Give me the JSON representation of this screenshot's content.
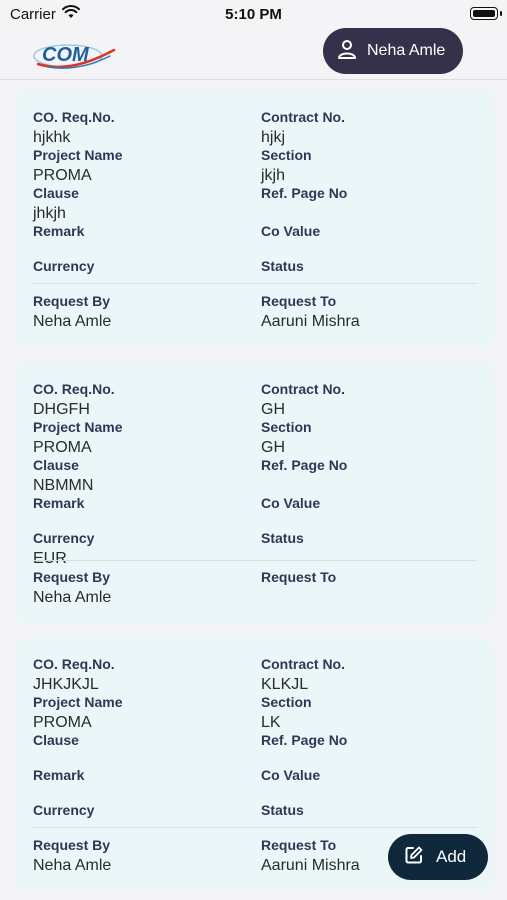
{
  "status": {
    "carrier": "Carrier",
    "time": "5:10 PM"
  },
  "header": {
    "logo_text": "COM",
    "user_name": "Neha Amle"
  },
  "labels": {
    "co_req_no": "CO. Req.No.",
    "contract_no": "Contract No.",
    "project_name": "Project Name",
    "section": "Section",
    "clause": "Clause",
    "ref_page_no": "Ref. Page No",
    "remark": "Remark",
    "co_value": "Co Value",
    "currency": "Currency",
    "status": "Status",
    "request_by": "Request By",
    "request_to": "Request To"
  },
  "cards": [
    {
      "co_req_no": "hjkhk",
      "contract_no": "hjkj",
      "project_name": "PROMA",
      "section": "jkjh",
      "clause": "jhkjh",
      "ref_page_no": "",
      "remark": "",
      "co_value": "",
      "currency": "",
      "status": "",
      "request_by": "Neha Amle",
      "request_to": "Aaruni Mishra"
    },
    {
      "co_req_no": "DHGFH",
      "contract_no": "GH",
      "project_name": "PROMA",
      "section": "GH",
      "clause": "NBMMN",
      "ref_page_no": "",
      "remark": "",
      "co_value": "",
      "currency": "EUR",
      "status": "",
      "request_by": "Neha Amle",
      "request_to": ""
    },
    {
      "co_req_no": "JHKJKJL",
      "contract_no": "KLKJL",
      "project_name": "PROMA",
      "section": "LK",
      "clause": "",
      "ref_page_no": "",
      "remark": "",
      "co_value": "",
      "currency": "",
      "status": "",
      "request_by": "Neha Amle",
      "request_to": "Aaruni Mishra"
    }
  ],
  "fab": {
    "label": "Add"
  }
}
